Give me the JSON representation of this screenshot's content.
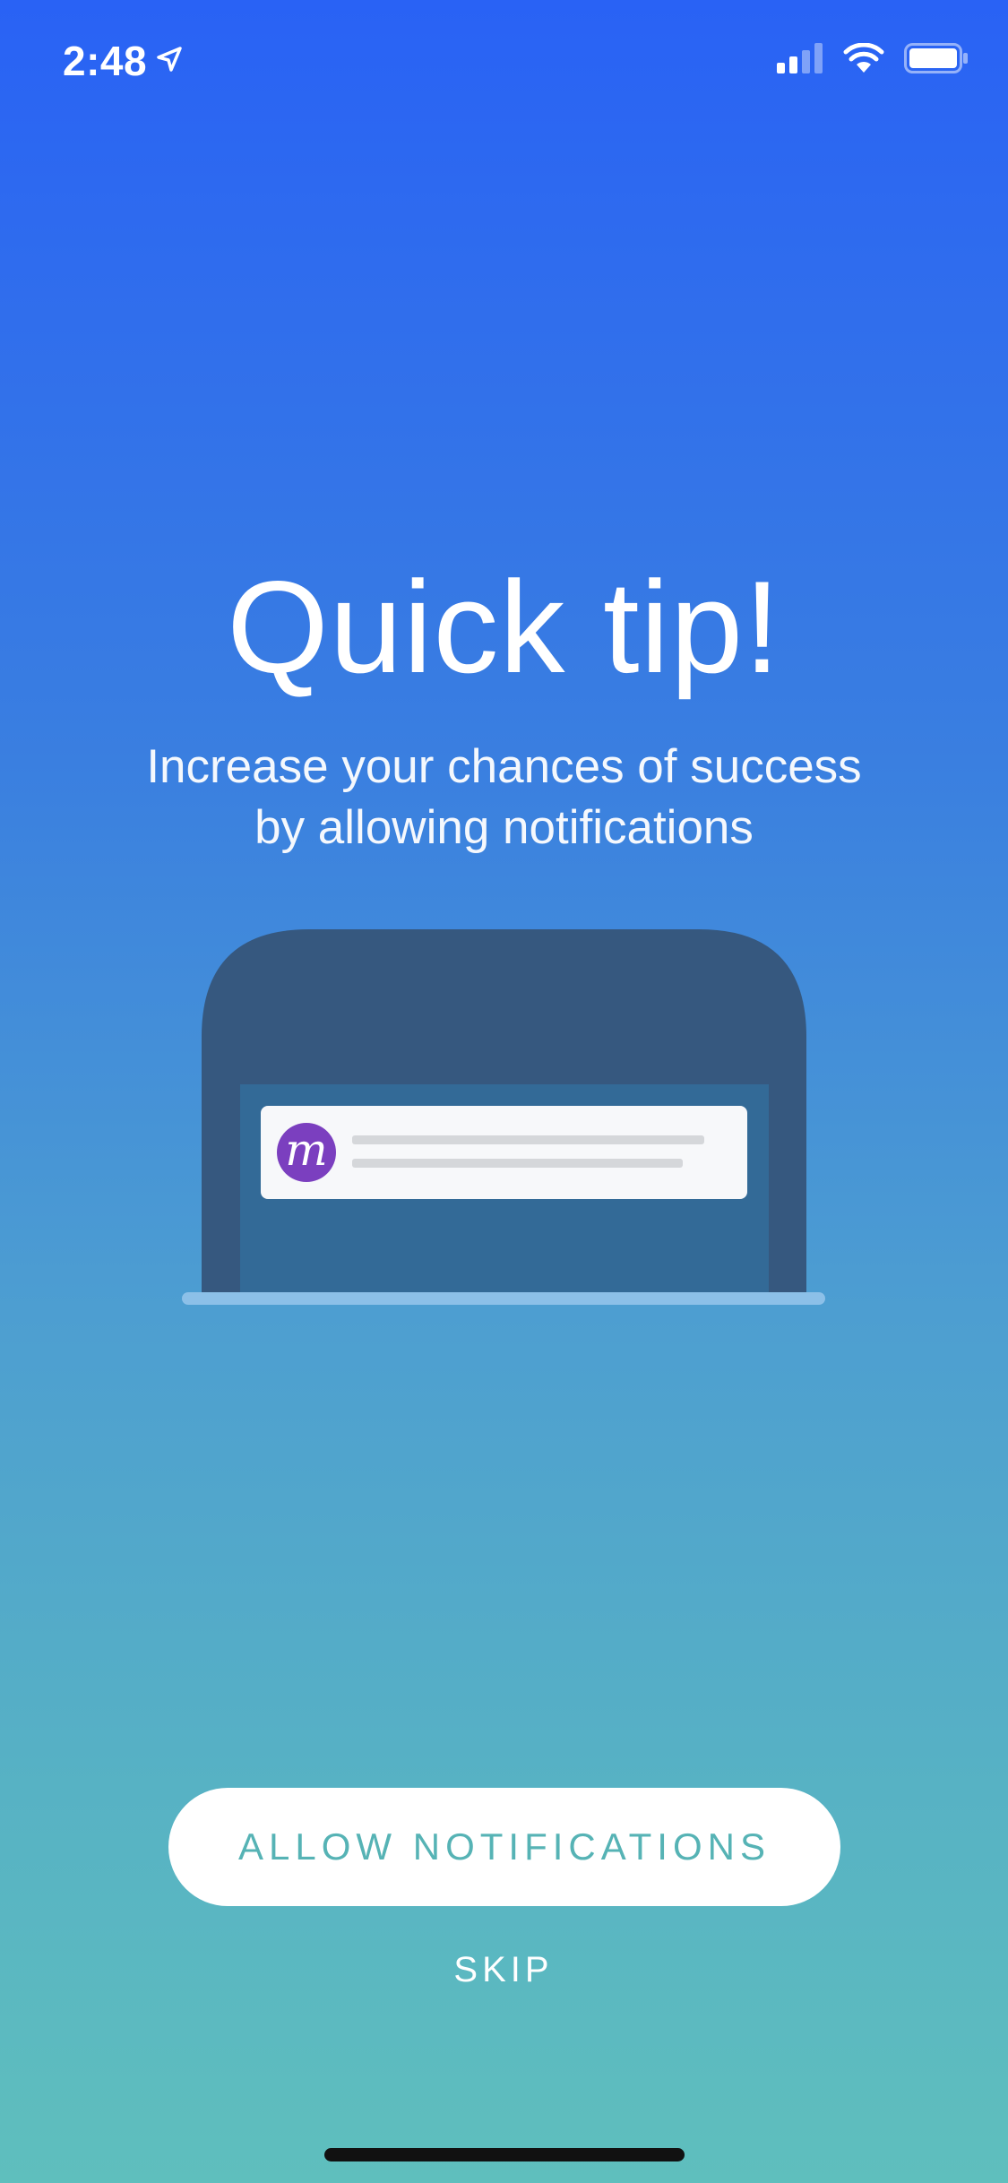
{
  "status_bar": {
    "time": "2:48",
    "icons": [
      "location-arrow-icon",
      "cellular-signal-icon",
      "wifi-icon",
      "battery-icon"
    ]
  },
  "content": {
    "title": "Quick tip!",
    "subtitle": "Increase your chances of success by allowing notifications"
  },
  "illustration": {
    "app_logo_letter": "m",
    "icons": [
      "laptop-illustration",
      "notification-card",
      "app-logo-icon"
    ]
  },
  "actions": {
    "allow_label": "ALLOW NOTIFICATIONS",
    "skip_label": "SKIP"
  },
  "colors": {
    "gradient_top": "#2962f5",
    "gradient_bottom": "#5fbfbd",
    "button_text": "#56b3b5",
    "logo_purple": "#7b3fbf"
  }
}
